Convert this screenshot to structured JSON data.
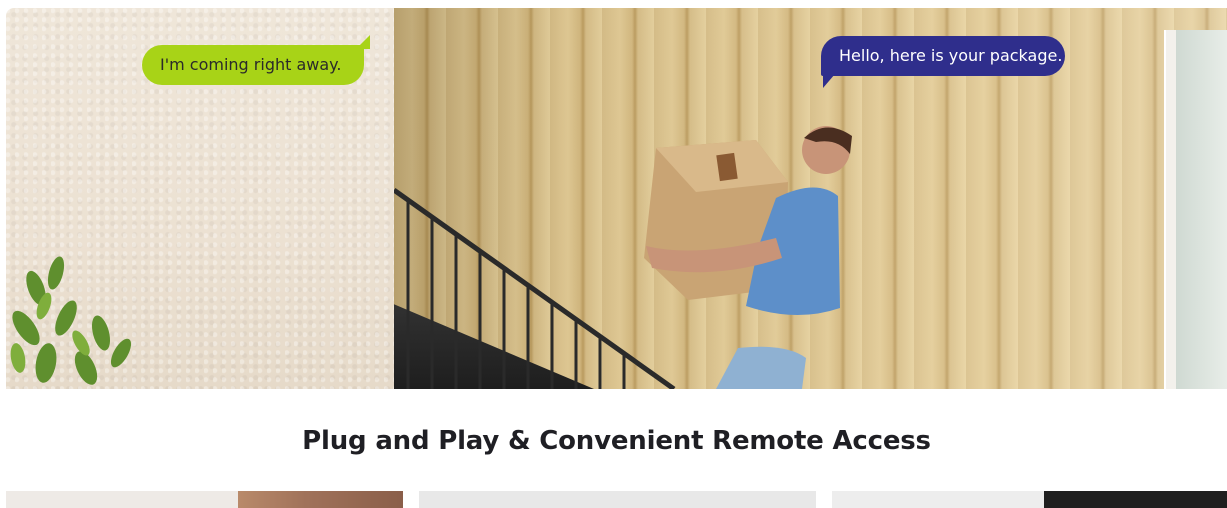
{
  "hero": {
    "bubble_left": "I'm coming right away.",
    "bubble_right": "Hello, here is your package."
  },
  "section": {
    "title": "Plug and Play & Convenient Remote Access"
  },
  "colors": {
    "bubble_green": "#a8d317",
    "bubble_blue": "#2f2e8c",
    "title_text": "#1f1f24"
  }
}
